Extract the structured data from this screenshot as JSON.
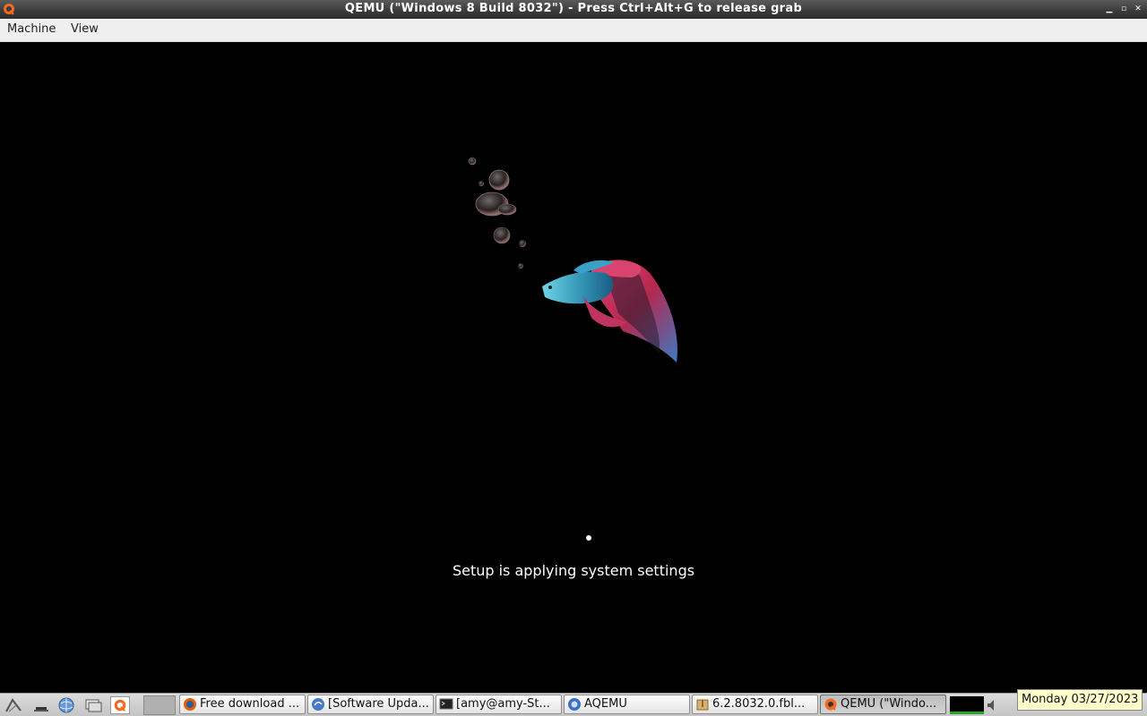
{
  "window": {
    "title": "QEMU (\"Windows 8 Build 8032\") - Press Ctrl+Alt+G to release grab"
  },
  "menubar": {
    "items": [
      {
        "label": "Machine"
      },
      {
        "label": "View"
      }
    ]
  },
  "guest": {
    "status_text": "Setup is applying system settings"
  },
  "taskbar": {
    "tasks": [
      {
        "label": "Free download ...",
        "icon": "firefox-icon"
      },
      {
        "label": "[Software Upda...",
        "icon": "software-update-icon"
      },
      {
        "label": "[amy@amy-St...",
        "icon": "terminal-icon"
      },
      {
        "label": "AQEMU",
        "icon": "aqemu-icon"
      },
      {
        "label": "6.2.8032.0.fbl...",
        "icon": "archive-icon"
      },
      {
        "label": "QEMU (\"Windo...",
        "icon": "qemu-icon"
      }
    ],
    "clock": "Monday 03/27/2023"
  },
  "colors": {
    "titlebar": "#3a3a3a",
    "menubar": "#efefef",
    "screen": "#000000",
    "taskbar": "#d0d0d0",
    "clock_tooltip": "#ffffcc"
  }
}
